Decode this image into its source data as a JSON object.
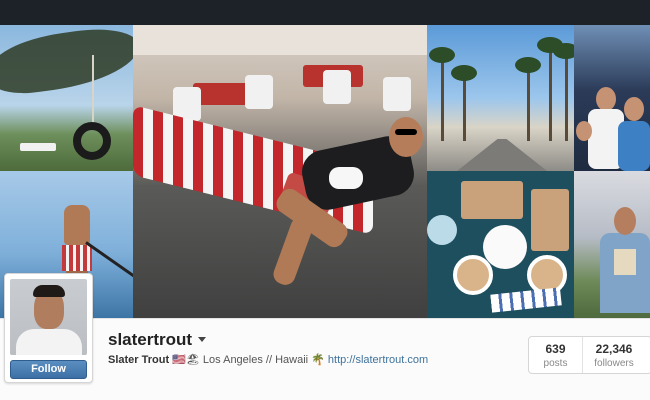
{
  "profile": {
    "username": "slatertrout",
    "full_name": "Slater Trout",
    "bio_flags": "🇺🇸🏖",
    "bio_location": "Los Angeles // Hawaii",
    "bio_icon": "🌴",
    "website": "http://slatertrout.com",
    "follow_label": "Follow"
  },
  "stats": [
    {
      "value": "639",
      "label": "posts"
    },
    {
      "value": "22,346",
      "label": "followers"
    }
  ],
  "colors": {
    "top_bar": "#1d2229",
    "follow_button": "#3d6fa5",
    "link": "#3f729b"
  },
  "icons": {
    "options": "chevron-down-icon"
  },
  "photos": [
    "tire-swing-photo",
    "paddleboard-photo",
    "hammock-photo",
    "palm-street-photo",
    "crowd-photo",
    "brunch-photo",
    "festival-photo"
  ]
}
